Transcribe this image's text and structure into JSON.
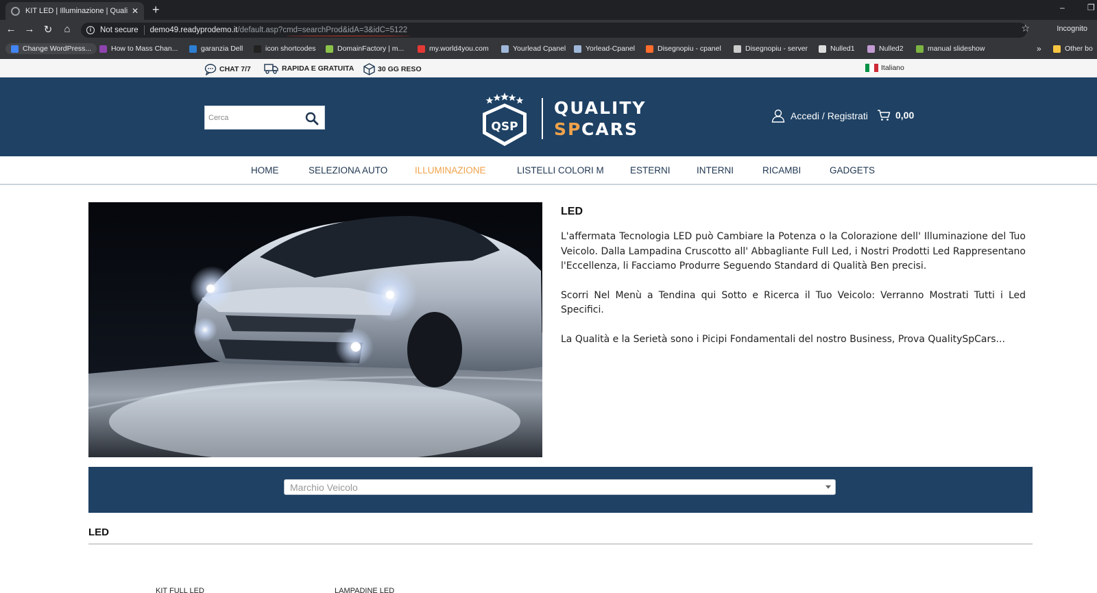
{
  "browser": {
    "tab_title": "KIT LED | Illuminazione | QualitySpCars",
    "security_label": "Not secure",
    "url_host": "demo49.readyprodemo.it",
    "url_path": "/default.asp?cmd=searchProd&idA=3&idC=5122",
    "profile_label": "Incognito",
    "bookmarks": [
      {
        "label": "Change WordPress...",
        "icon": "globe-icon",
        "color": "#4285f4"
      },
      {
        "label": "How to Mass Chan...",
        "icon": "tab-icon",
        "color": "#8e44ad"
      },
      {
        "label": "garanzia Dell",
        "icon": "dell-icon",
        "color": "#2d7fd3"
      },
      {
        "label": "icon shortcodes",
        "icon": "x-icon",
        "color": "#222222"
      },
      {
        "label": "DomainFactory | m...",
        "icon": "df-icon",
        "color": "#8bc34a"
      },
      {
        "label": "my.world4you.com",
        "icon": "w4y-icon",
        "color": "#e53935"
      },
      {
        "label": "Yourlead Cpanel",
        "icon": "page-icon",
        "color": "#9fb8d9"
      },
      {
        "label": "Yorlead-Cpanel",
        "icon": "page-icon",
        "color": "#9fb8d9"
      },
      {
        "label": "Disegnopiu - cpanel",
        "icon": "cp-icon",
        "color": "#ff6c2c"
      },
      {
        "label": "Disegnopiu - server",
        "icon": "brackets-icon",
        "color": "#cccccc"
      },
      {
        "label": "Nulled1",
        "icon": "globe-icon",
        "color": "#dddddd"
      },
      {
        "label": "Nulled2",
        "icon": "page-icon",
        "color": "#c39bd3"
      },
      {
        "label": "manual slideshow",
        "icon": "slides-icon",
        "color": "#7cb342"
      }
    ],
    "other_bookmarks": "Other bo"
  },
  "infobar": {
    "items": [
      {
        "label": "CHAT 7/7",
        "icon": "chat-icon"
      },
      {
        "label": "RAPIDA E GRATUITA",
        "icon": "truck-icon"
      },
      {
        "label": "30 GG RESO",
        "icon": "box-icon"
      }
    ],
    "language": "Italiano"
  },
  "header": {
    "search_placeholder": "Cerca",
    "logo_text_top": "QUALITY",
    "logo_text_sp": "SP",
    "logo_text_cars": "CARS",
    "logo_badge": "QSP",
    "account_label": "Accedi / Registrati",
    "cart_total": "0,00"
  },
  "nav": {
    "items": [
      {
        "label": "HOME",
        "active": false
      },
      {
        "label": "SELEZIONA AUTO",
        "active": false
      },
      {
        "label": "ILLUMINAZIONE",
        "active": true
      },
      {
        "label": "LISTELLI COLORI M",
        "active": false
      },
      {
        "label": "ESTERNI",
        "active": false
      },
      {
        "label": "INTERNI",
        "active": false
      },
      {
        "label": "RICAMBI",
        "active": false
      },
      {
        "label": "GADGETS",
        "active": false
      }
    ]
  },
  "content": {
    "title": "LED",
    "paragraphs": [
      "L'affermata Tecnologia LED può Cambiare la Potenza o la Colorazione dell' Illuminazione del Tuo Veicolo. Dalla Lampadina Cruscotto all' Abbagliante Full Led, i Nostri Prodotti Led Rappresentano l'Eccellenza, li Facciamo Produrre Seguendo Standard di Qualità Ben precisi.",
      "Scorri Nel Menù a Tendina qui Sotto e Ricerca il Tuo Veicolo: Verranno Mostrati Tutti i Led Specifici.",
      "La Qualità e la Serietà sono i Picipi Fondamentali del nostro Business, Prova QualitySpCars..."
    ]
  },
  "filter": {
    "select_value": "Marchio Veicolo"
  },
  "section": {
    "title": "LED",
    "categories": [
      "KIT FULL LED",
      "LAMPADINE LED"
    ]
  },
  "colors": {
    "brand_blue": "#1e4164",
    "accent_orange": "#f0a24a"
  }
}
